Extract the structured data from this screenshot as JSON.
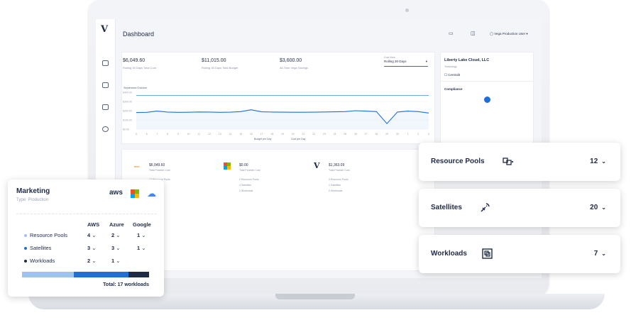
{
  "dashboard": {
    "title": "Dashboard",
    "user": "Vega Production User",
    "kpis": [
      {
        "value": "$6,049.60",
        "label": "Rolling 30 Days Total Cost"
      },
      {
        "value": "$11,015.00",
        "label": "Rolling 30 Days Total Budget"
      },
      {
        "value": "$3,600.00",
        "label": "All-Time Vega Savings"
      }
    ],
    "cost_view_label": "Cost View",
    "cost_view_value": "Rolling 30 Days",
    "chart_label": "September/October",
    "y_ticks": [
      "$400.00",
      "$300.00",
      "$200.00",
      "$100.00",
      "$0.00"
    ],
    "x_ticks": [
      "5",
      "6",
      "7",
      "8",
      "9",
      "10",
      "11",
      "12",
      "13",
      "14",
      "15",
      "16",
      "17",
      "18",
      "19",
      "20",
      "21",
      "22",
      "23",
      "24",
      "25",
      "26",
      "27",
      "28",
      "29",
      "30",
      "1",
      "2",
      "3"
    ],
    "legend": [
      "Budget per Day",
      "Cost per Day"
    ],
    "org": {
      "name": "Liberty Lake Cloud, LLC",
      "type": "Technology",
      "item": "Centralit"
    },
    "compliance_label": "Compliance",
    "providers": [
      {
        "icon": "aws",
        "value": "$6,049.60",
        "label": "Total Provider Cost",
        "lines": [
          "10 Resource Pools",
          "3 Satellites",
          "6 Workloads"
        ]
      },
      {
        "icon": "azure",
        "value": "$0.00",
        "label": "Total Provider Cost",
        "lines": [
          "2 Resource Pools",
          "4 Satellites",
          "2 Workloads"
        ]
      },
      {
        "icon": "vega",
        "value": "$1,363.09",
        "label": "Total Provider Cost",
        "lines": [
          "3 Resource Pools",
          "1 Satellites",
          "0 Workloads"
        ]
      }
    ]
  },
  "marketing": {
    "title": "Marketing",
    "type": "Type: Production",
    "columns": [
      "AWS",
      "Azure",
      "Google"
    ],
    "rows": [
      {
        "label": "Resource Pools",
        "color": "#9ec3f0",
        "aws": "4",
        "azure": "2",
        "google": "1"
      },
      {
        "label": "Satellites",
        "color": "#1f6fd6",
        "aws": "3",
        "azure": "3",
        "google": "1"
      },
      {
        "label": "Workloads",
        "color": "#1f2a44",
        "aws": "2",
        "azure": "1",
        "google": ""
      }
    ],
    "progress": [
      0.41,
      0.43,
      0.16
    ],
    "total": "Total: 17 workloads"
  },
  "summary": [
    {
      "label": "Resource Pools",
      "count": "12",
      "icon": "cube-cluster-icon"
    },
    {
      "label": "Satellites",
      "count": "20",
      "icon": "satellite-icon"
    },
    {
      "label": "Workloads",
      "count": "7",
      "icon": "workloads-icon"
    }
  ],
  "chart_data": {
    "type": "line",
    "title": "September/October",
    "x": [
      "5",
      "6",
      "7",
      "8",
      "9",
      "10",
      "11",
      "12",
      "13",
      "14",
      "15",
      "16",
      "17",
      "18",
      "19",
      "20",
      "21",
      "22",
      "23",
      "24",
      "25",
      "26",
      "27",
      "28",
      "29",
      "30",
      "1",
      "2",
      "3"
    ],
    "ylim": [
      0,
      400
    ],
    "series": [
      {
        "name": "Budget per Day",
        "values": [
          367,
          367,
          367,
          367,
          367,
          367,
          367,
          367,
          367,
          367,
          367,
          367,
          367,
          367,
          367,
          367,
          367,
          367,
          367,
          367,
          367,
          367,
          367,
          367,
          367,
          367,
          367,
          367,
          367
        ]
      },
      {
        "name": "Cost per Day",
        "values": [
          180,
          182,
          195,
          185,
          182,
          183,
          186,
          185,
          182,
          184,
          190,
          210,
          188,
          185,
          184,
          183,
          183,
          184,
          186,
          188,
          190,
          200,
          195,
          190,
          60,
          185,
          195,
          190,
          175
        ]
      }
    ]
  }
}
